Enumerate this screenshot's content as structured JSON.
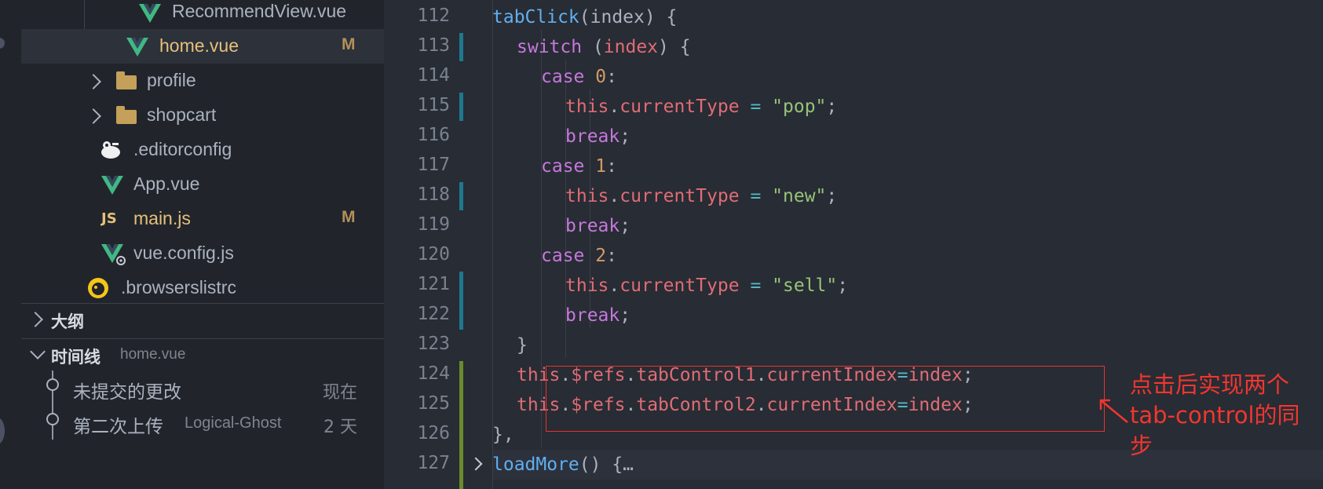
{
  "explorer": {
    "files": [
      {
        "label": "RecommendView.vue",
        "icon": "vue-icon",
        "badge": ""
      },
      {
        "label": "home.vue",
        "icon": "vue-icon",
        "badge": "M"
      },
      {
        "label": "profile",
        "icon": "folder-icon",
        "badge": ""
      },
      {
        "label": "shopcart",
        "icon": "folder-icon",
        "badge": ""
      },
      {
        "label": ".editorconfig",
        "icon": "editorconfig-icon",
        "badge": ""
      },
      {
        "label": "App.vue",
        "icon": "vue-icon",
        "badge": ""
      },
      {
        "label": "main.js",
        "icon": "js-icon",
        "badge": "M"
      },
      {
        "label": "vue.config.js",
        "icon": "vue-config-icon",
        "badge": ""
      },
      {
        "label": ".browserslistrc",
        "icon": "browserslist-icon",
        "badge": ""
      }
    ],
    "js_icon_text": "JS"
  },
  "outline": {
    "title": "大纲"
  },
  "timeline": {
    "title": "时间线",
    "file": "home.vue",
    "items": [
      {
        "label": "未提交的更改",
        "author": "",
        "when": "现在"
      },
      {
        "label": "第二次上传",
        "author": "Logical-Ghost",
        "when": "2 天"
      }
    ]
  },
  "editor": {
    "line_numbers": [
      "112",
      "113",
      "114",
      "115",
      "116",
      "117",
      "118",
      "119",
      "120",
      "121",
      "122",
      "123",
      "124",
      "125",
      "126",
      "127"
    ],
    "lines": [
      [
        [
          "fn",
          "tabClick"
        ],
        [
          "pl",
          "(index) {"
        ]
      ],
      [
        [
          "kw",
          "switch"
        ],
        [
          "pl",
          " ("
        ],
        [
          "var",
          "index"
        ],
        [
          "pl",
          ") {"
        ]
      ],
      [
        [
          "kw",
          "case"
        ],
        [
          "pl",
          " "
        ],
        [
          "num",
          "0"
        ],
        [
          "pl",
          ":"
        ]
      ],
      [
        [
          "var",
          "this"
        ],
        [
          "pl",
          "."
        ],
        [
          "var",
          "currentType"
        ],
        [
          "pl",
          " "
        ],
        [
          "op",
          "="
        ],
        [
          "pl",
          " "
        ],
        [
          "str",
          "\"pop\""
        ],
        [
          "pl",
          ";"
        ]
      ],
      [
        [
          "kw",
          "break"
        ],
        [
          "pl",
          ";"
        ]
      ],
      [
        [
          "kw",
          "case"
        ],
        [
          "pl",
          " "
        ],
        [
          "num",
          "1"
        ],
        [
          "pl",
          ":"
        ]
      ],
      [
        [
          "var",
          "this"
        ],
        [
          "pl",
          "."
        ],
        [
          "var",
          "currentType"
        ],
        [
          "pl",
          " "
        ],
        [
          "op",
          "="
        ],
        [
          "pl",
          " "
        ],
        [
          "str",
          "\"new\""
        ],
        [
          "pl",
          ";"
        ]
      ],
      [
        [
          "kw",
          "break"
        ],
        [
          "pl",
          ";"
        ]
      ],
      [
        [
          "kw",
          "case"
        ],
        [
          "pl",
          " "
        ],
        [
          "num",
          "2"
        ],
        [
          "pl",
          ":"
        ]
      ],
      [
        [
          "var",
          "this"
        ],
        [
          "pl",
          "."
        ],
        [
          "var",
          "currentType"
        ],
        [
          "pl",
          " "
        ],
        [
          "op",
          "="
        ],
        [
          "pl",
          " "
        ],
        [
          "str",
          "\"sell\""
        ],
        [
          "pl",
          ";"
        ]
      ],
      [
        [
          "kw",
          "break"
        ],
        [
          "pl",
          ";"
        ]
      ],
      [
        [
          "pl",
          "}"
        ]
      ],
      [
        [
          "var",
          "this"
        ],
        [
          "pl",
          "."
        ],
        [
          "var",
          "$refs"
        ],
        [
          "pl",
          "."
        ],
        [
          "var",
          "tabControl1"
        ],
        [
          "pl",
          "."
        ],
        [
          "var",
          "currentIndex"
        ],
        [
          "op",
          "="
        ],
        [
          "var",
          "index"
        ],
        [
          "pl",
          ";"
        ]
      ],
      [
        [
          "var",
          "this"
        ],
        [
          "pl",
          "."
        ],
        [
          "var",
          "$refs"
        ],
        [
          "pl",
          "."
        ],
        [
          "var",
          "tabControl2"
        ],
        [
          "pl",
          "."
        ],
        [
          "var",
          "currentIndex"
        ],
        [
          "op",
          "="
        ],
        [
          "var",
          "index"
        ],
        [
          "pl",
          ";"
        ]
      ],
      [
        [
          "pl",
          "},"
        ]
      ],
      [
        [
          "fn",
          "loadMore"
        ],
        [
          "pl",
          "() {"
        ],
        [
          "pl",
          "…"
        ]
      ]
    ]
  },
  "annotation": {
    "text": "点击后实现两个tab-control的同步"
  },
  "colors": {
    "sidebar_bg": "#21252b",
    "editor_bg": "#282c34",
    "modified": "#e5c07b",
    "annotation_red": "#f1362f",
    "vue_green": "#41b883"
  }
}
